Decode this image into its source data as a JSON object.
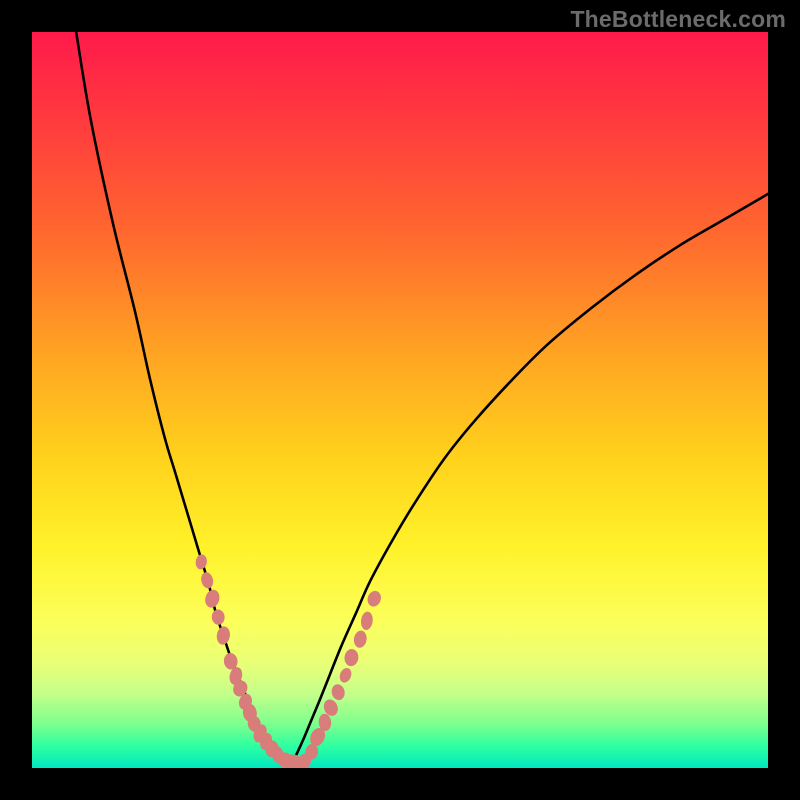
{
  "watermark": "TheBottleneck.com",
  "chart_data": {
    "type": "line",
    "title": "",
    "xlabel": "",
    "ylabel": "",
    "xlim": [
      0,
      100
    ],
    "ylim": [
      0,
      100
    ],
    "grid": false,
    "legend": false,
    "series": [
      {
        "name": "left-curve",
        "x": [
          6,
          8,
          11,
          14,
          16,
          18,
          19.5,
          21,
          22.5,
          24,
          25,
          26,
          27,
          28,
          29,
          30,
          31,
          32,
          33,
          34,
          35
        ],
        "values": [
          100,
          88,
          74,
          62,
          53,
          45,
          40,
          35,
          30,
          25,
          21,
          18,
          15,
          12.5,
          10,
          7.5,
          5.5,
          3.8,
          2.4,
          1.2,
          0
        ]
      },
      {
        "name": "right-curve",
        "x": [
          35,
          36,
          37,
          38,
          39,
          40,
          42,
          44,
          46,
          49,
          52,
          56,
          60,
          65,
          70,
          76,
          82,
          88,
          94,
          100
        ],
        "values": [
          0,
          2,
          4.2,
          6.6,
          9,
          11.5,
          16.5,
          21,
          25.5,
          31,
          36,
          42,
          47,
          52.5,
          57.5,
          62.5,
          67,
          71,
          74.5,
          78
        ]
      }
    ],
    "markers": {
      "name": "highlight-dots",
      "color": "#d97d7a",
      "x": [
        23,
        23.8,
        24.5,
        25.3,
        26,
        27,
        27.7,
        28.3,
        29,
        29.6,
        30.2,
        31,
        31.8,
        32.6,
        33.4,
        34.3,
        35,
        35.8,
        37,
        38,
        38.8,
        39.8,
        40.6,
        41.6,
        42.6,
        43.4,
        44.6,
        45.5,
        46.5
      ],
      "values": [
        28,
        25.5,
        23,
        20.5,
        18,
        14.5,
        12.5,
        10.8,
        9,
        7.5,
        6,
        4.7,
        3.6,
        2.6,
        1.8,
        1.1,
        0.6,
        0.6,
        0.9,
        2.2,
        4.2,
        6.2,
        8.2,
        10.3,
        12.6,
        15,
        17.5,
        20,
        23
      ]
    }
  }
}
